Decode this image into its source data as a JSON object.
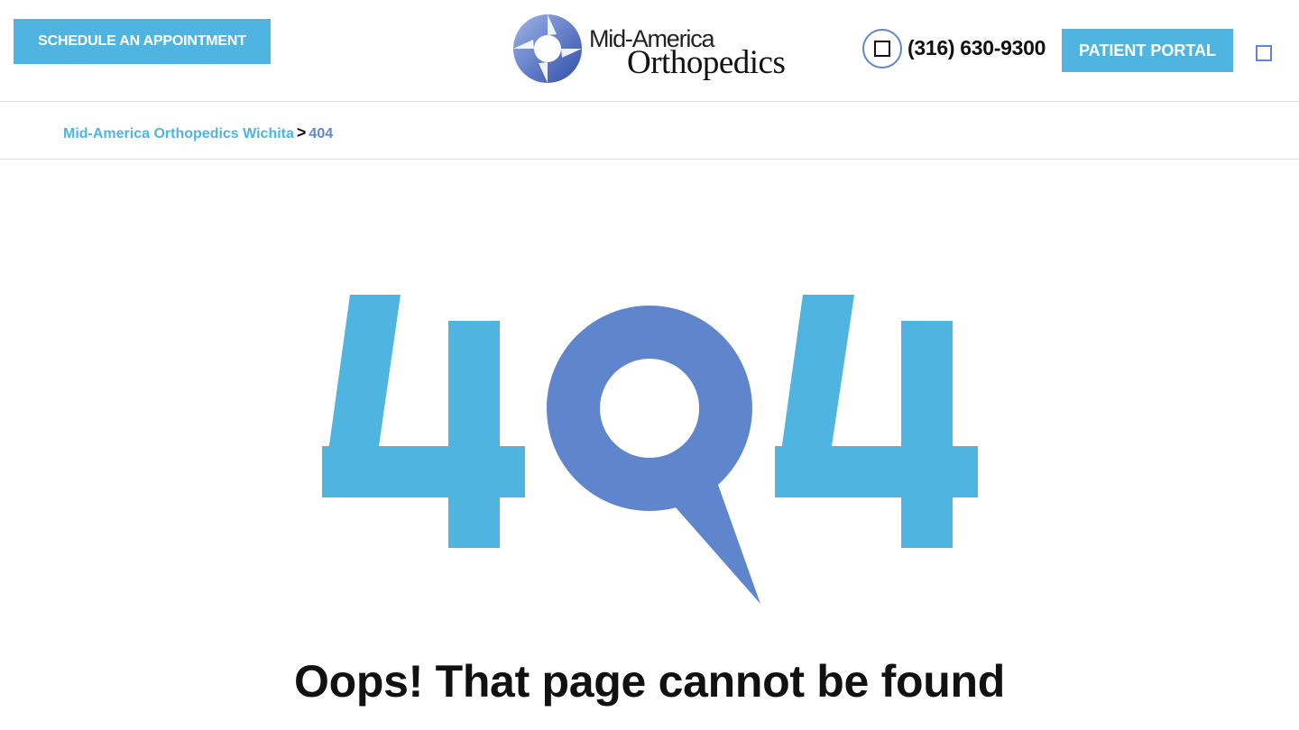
{
  "header": {
    "schedule_label": "SCHEDULE AN APPOINTMENT",
    "logo_line1": "Mid-America",
    "logo_line2": "Orthopedics",
    "phone_icon": "phone-icon",
    "phone_number": "(316) 630-9300",
    "portal_label": "PATIENT PORTAL",
    "menu_icon": "menu-icon"
  },
  "breadcrumb": {
    "home_label": "Mid-America Orthopedics Wichita",
    "separator": ">",
    "current_label": "404"
  },
  "error": {
    "graphic_text": "404",
    "heading": "Oops! That page cannot be found"
  },
  "colors": {
    "accent_light": "#4fb5e0",
    "accent_dark": "#5f86cc",
    "text": "#111111",
    "border": "#dcdcdc"
  }
}
